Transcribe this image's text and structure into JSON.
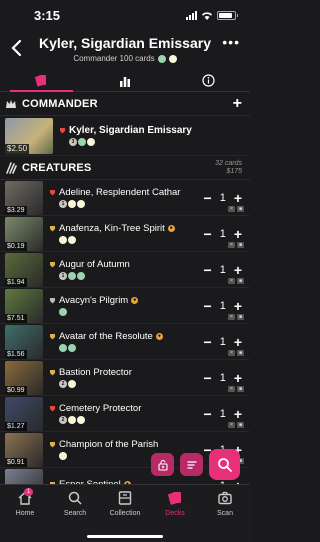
{
  "status": {
    "time": "3:15"
  },
  "header": {
    "title": "Kyler, Sigardian Emissary",
    "subtitle": "Commander 100 cards"
  },
  "colors": {
    "accent": "#e8307a",
    "green_mana": "#9bd3ae",
    "white_mana": "#f8f6d8"
  },
  "commander_section": {
    "title": "COMMANDER",
    "card": {
      "name": "Kyler, Sigardian Emissary",
      "price": "$2.50",
      "mana": [
        "3",
        "G",
        "W"
      ]
    }
  },
  "creatures_section": {
    "title": "CREATURES",
    "count_label": "32 cards",
    "total_label": "$175",
    "cards": [
      {
        "name": "Adeline, Resplendent Cathar",
        "price": "$3.29",
        "qty": "1",
        "mana": [
          "1",
          "W",
          "W"
        ],
        "rarity": "mythic",
        "art": "#6f6a62",
        "badge": false
      },
      {
        "name": "Anafenza, Kin-Tree Spirit",
        "price": "$0.19",
        "qty": "1",
        "mana": [
          "W",
          "W"
        ],
        "rarity": "rare",
        "art": "#7b8a6a",
        "badge": true
      },
      {
        "name": "Augur of Autumn",
        "price": "$1.94",
        "qty": "1",
        "mana": [
          "1",
          "G",
          "G"
        ],
        "rarity": "rare",
        "art": "#5a6b3a",
        "badge": false
      },
      {
        "name": "Avacyn's Pilgrim",
        "price": "$7.51",
        "qty": "1",
        "mana": [
          "G"
        ],
        "rarity": "common",
        "art": "#5d7a3f",
        "badge": true
      },
      {
        "name": "Avatar of the Resolute",
        "price": "$1.56",
        "qty": "1",
        "mana": [
          "G",
          "G"
        ],
        "rarity": "rare",
        "art": "#3f6e6a",
        "badge": true
      },
      {
        "name": "Bastion Protector",
        "price": "$0.99",
        "qty": "1",
        "mana": [
          "2",
          "W"
        ],
        "rarity": "rare",
        "art": "#8a6a3a",
        "badge": false
      },
      {
        "name": "Cemetery Protector",
        "price": "$1.27",
        "qty": "1",
        "mana": [
          "2",
          "W",
          "W"
        ],
        "rarity": "mythic",
        "art": "#3e4a6a",
        "badge": false
      },
      {
        "name": "Champion of the Parish",
        "price": "$0.91",
        "qty": "1",
        "mana": [
          "W"
        ],
        "rarity": "rare",
        "art": "#8a7250",
        "badge": false
      },
      {
        "name": "Esper Sentinel",
        "price": "",
        "qty": "1",
        "mana": [],
        "rarity": "rare",
        "art": "#7a8090",
        "badge": true
      }
    ]
  },
  "nav": [
    {
      "label": "Home",
      "badge": "1"
    },
    {
      "label": "Search"
    },
    {
      "label": "Collection"
    },
    {
      "label": "Decks"
    },
    {
      "label": "Scan"
    }
  ]
}
